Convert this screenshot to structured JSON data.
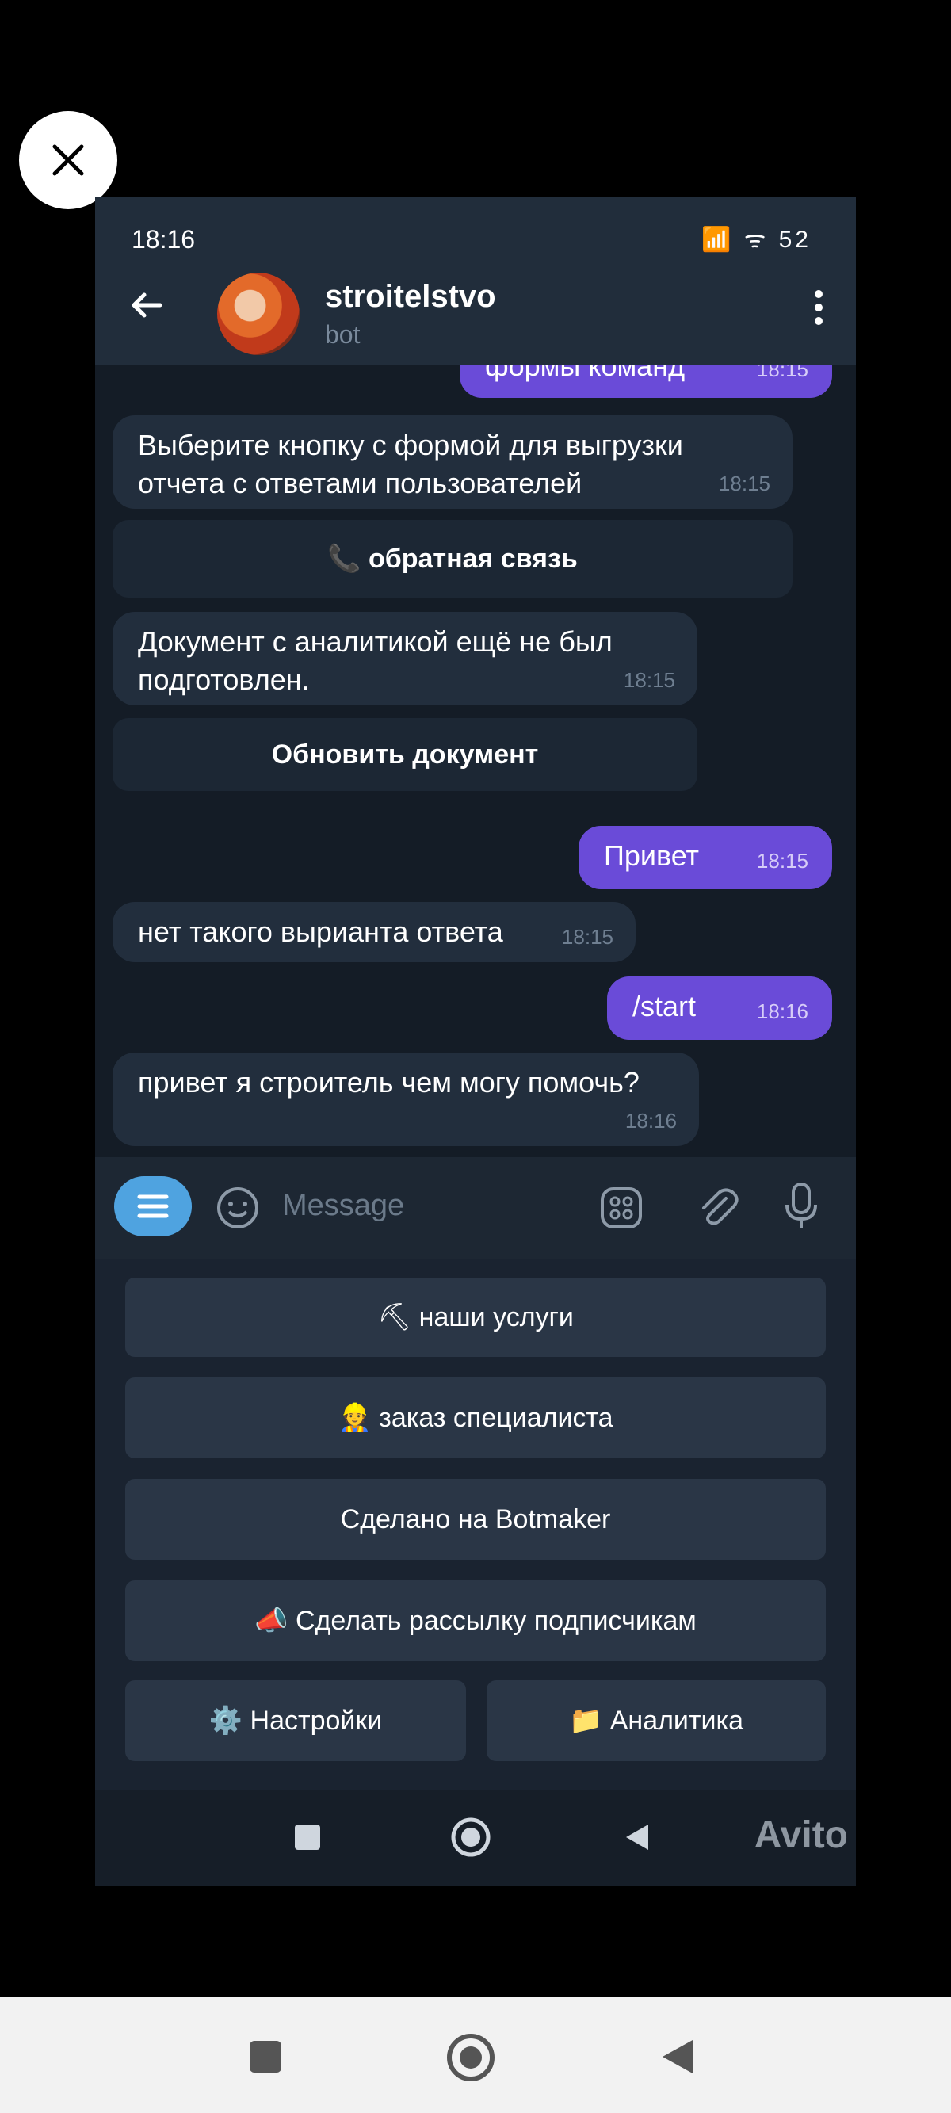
{
  "viewer": {
    "close_label": "×"
  },
  "status_bar": {
    "time": "18:16",
    "icons": "📶 ᯤ 52"
  },
  "header": {
    "title": "stroitelstvo",
    "subtitle": "bot"
  },
  "messages": [
    {
      "side": "out",
      "text": "формы команд",
      "time": "18:15"
    },
    {
      "side": "in",
      "text": "Выберите кнопку с формой для выгрузки отчета с ответами пользователей",
      "time": "18:15"
    },
    {
      "side": "btn",
      "text": "📞 обратная связь"
    },
    {
      "side": "in",
      "text": "Документ с аналитикой ещё не был подготовлен.",
      "time": "18:15"
    },
    {
      "side": "btn",
      "text": "Обновить документ"
    },
    {
      "side": "out",
      "text": "Привет",
      "time": "18:15"
    },
    {
      "side": "in",
      "text": "нет такого выриантa ответа",
      "time": "18:15"
    },
    {
      "side": "out",
      "text": "/start",
      "time": "18:16"
    },
    {
      "side": "in",
      "text": "привет я строитель чем могу помочь?",
      "time": "18:16"
    }
  ],
  "input": {
    "placeholder": "Message"
  },
  "keyboard": {
    "b1": "⛏ наши услуги",
    "b2": "👷 заказ специалиста",
    "b3": "Сделано на Botmaker",
    "b4": "📣 Сделать рассылку подписчикам",
    "b5": "⚙️ Настройки",
    "b6": "📁 Аналитика"
  },
  "watermark": "Avito"
}
